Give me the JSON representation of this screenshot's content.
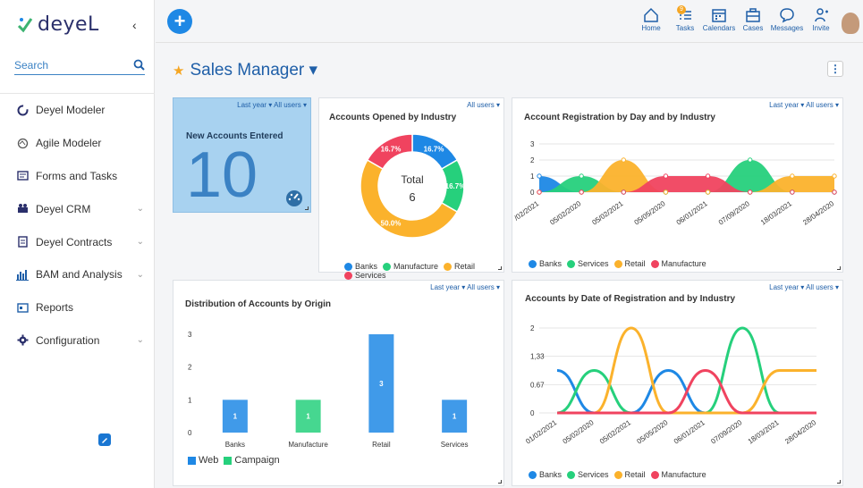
{
  "app": {
    "logo_text": "deyeL",
    "collapse_icon": "chevron-left-icon"
  },
  "search": {
    "placeholder": "Search"
  },
  "sidebar": {
    "items": [
      {
        "label": "Deyel Modeler",
        "icon": "modeler-icon",
        "expandable": false
      },
      {
        "label": "Agile Modeler",
        "icon": "agile-icon",
        "expandable": false
      },
      {
        "label": "Forms and Tasks",
        "icon": "forms-icon",
        "expandable": false
      },
      {
        "label": "Deyel CRM",
        "icon": "crm-icon",
        "expandable": true
      },
      {
        "label": "Deyel Contracts",
        "icon": "contracts-icon",
        "expandable": true
      },
      {
        "label": "BAM and Analysis",
        "icon": "bam-icon",
        "expandable": true
      },
      {
        "label": "Reports",
        "icon": "reports-icon",
        "expandable": false
      },
      {
        "label": "Configuration",
        "icon": "gear-icon",
        "expandable": true
      }
    ]
  },
  "topnav": {
    "home": "Home",
    "tasks": "Tasks",
    "tasks_badge": "9",
    "calendars": "Calendars",
    "cases": "Cases",
    "messages": "Messages",
    "invite": "Invite"
  },
  "page": {
    "title": "Sales Manager ▾"
  },
  "colors": {
    "banks": "#1e88e5",
    "services": "#26d07c",
    "retail": "#fbb22c",
    "manufacture": "#f0435f",
    "accent": "#1f5fa8"
  },
  "kpi": {
    "filter": "Last year ▾  All users ▾",
    "title": "New Accounts Entered",
    "value": "10"
  },
  "donut": {
    "filter": "All users ▾",
    "title": "Accounts Opened by Industry",
    "center_label": "Total",
    "center_value": "6",
    "legend": [
      "Banks",
      "Manufacture",
      "Retail",
      "Services"
    ]
  },
  "area_chart": {
    "filter": "Last year ▾  All users ▾",
    "title": "Account Registration by Day and by Industry",
    "legend": [
      "Banks",
      "Services",
      "Retail",
      "Manufacture"
    ]
  },
  "bar_chart": {
    "filter": "Last year ▾  All users ▾",
    "title": "Distribution of Accounts by Origin",
    "legend": [
      "Web",
      "Campaign"
    ]
  },
  "line_chart": {
    "filter": "Last year ▾  All users ▾",
    "title": "Accounts by Date of Registration and by Industry",
    "legend": [
      "Banks",
      "Services",
      "Retail",
      "Manufacture"
    ]
  },
  "chart_data": [
    {
      "type": "pie",
      "title": "Accounts Opened by Industry",
      "categories": [
        "Banks",
        "Manufacture",
        "Retail",
        "Services"
      ],
      "values": [
        1,
        1,
        3,
        1
      ],
      "labels": [
        "16.7%",
        "16.7%",
        "50.0%",
        "16.7%"
      ],
      "total": 6
    },
    {
      "type": "area",
      "title": "Account Registration by Day and by Industry",
      "categories": [
        "01/02/2021",
        "05/02/2020",
        "05/02/2021",
        "05/05/2020",
        "06/01/2021",
        "07/09/2020",
        "18/03/2021",
        "28/04/2020"
      ],
      "tick_labels": [
        "/02/2021",
        "05/02/2020",
        "05/02/2021",
        "05/05/2020",
        "06/01/2021",
        "07/09/2020",
        "18/03/2021",
        "28/04/2020"
      ],
      "ylim": [
        0,
        3
      ],
      "yticks": [
        0,
        1,
        2,
        3
      ],
      "series": [
        {
          "name": "Banks",
          "values": [
            1,
            0,
            0,
            0,
            0,
            0,
            0,
            0
          ]
        },
        {
          "name": "Services",
          "values": [
            0,
            1,
            0,
            0,
            0,
            2,
            0,
            0
          ]
        },
        {
          "name": "Retail",
          "values": [
            0,
            0,
            2,
            0,
            0,
            0,
            1,
            1
          ]
        },
        {
          "name": "Manufacture",
          "values": [
            0,
            0,
            0,
            1,
            1,
            0,
            0,
            0
          ]
        }
      ]
    },
    {
      "type": "bar",
      "title": "Distribution of Accounts by Origin",
      "categories": [
        "Banks",
        "Manufacture",
        "Retail",
        "Services"
      ],
      "ylim": [
        0,
        3
      ],
      "yticks": [
        0,
        1,
        2,
        3
      ],
      "series": [
        {
          "name": "Web",
          "values": [
            1,
            0,
            3,
            1
          ]
        },
        {
          "name": "Campaign",
          "values": [
            0,
            1,
            0,
            0
          ]
        }
      ]
    },
    {
      "type": "line",
      "title": "Accounts by Date of Registration and by Industry",
      "categories": [
        "01/02/2021",
        "05/02/2020",
        "05/02/2021",
        "05/05/2020",
        "06/01/2021",
        "07/09/2020",
        "18/03/2021",
        "28/04/2020"
      ],
      "ylim": [
        0,
        2
      ],
      "yticks": [
        "0",
        "0.67",
        "1,33",
        "2"
      ],
      "series": [
        {
          "name": "Banks",
          "values": [
            1,
            0,
            0,
            1,
            0,
            0,
            0,
            0
          ]
        },
        {
          "name": "Services",
          "values": [
            0,
            1,
            0,
            0,
            0,
            2,
            0,
            0
          ]
        },
        {
          "name": "Retail",
          "values": [
            0,
            0,
            2,
            0,
            0,
            0,
            1,
            1
          ]
        },
        {
          "name": "Manufacture",
          "values": [
            0,
            0,
            0,
            0,
            1,
            0,
            0,
            0
          ]
        }
      ]
    }
  ]
}
